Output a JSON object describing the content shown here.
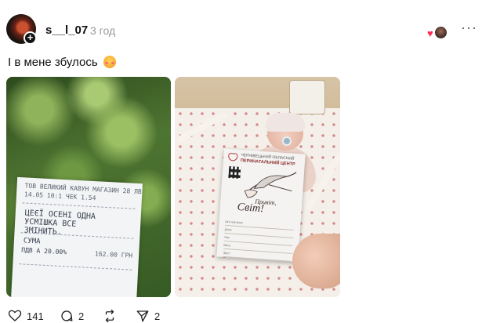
{
  "post": {
    "username": "s__l_07",
    "timestamp": "3 год",
    "caption": "І в мене збулось",
    "emoji": "flushed-face-emoji"
  },
  "icons": {
    "more": "more-options-icon",
    "plus": "follow-plus-icon",
    "heart": "heart-icon"
  },
  "images": {
    "left": {
      "kind": "photo of receipt in front of green foliage",
      "receipt_line1": "ТОВ ВЕЛИКИЙ КАВУН МАГАЗИН 28 ЛВ",
      "receipt_line2": "14.05 10:1 ЧЕК 1.54",
      "receipt_message": "ЦЕЄЇ ОСЕНІ ОДНА УСМІШКА ВСЕ ЗМІНИТЬ.",
      "receipt_sum": "СУМА",
      "receipt_sum_line": "ПДВ А 20.00%",
      "receipt_price": "162.00 ГРН"
    },
    "right": {
      "kind": "photo of newborn in crib with greeting card",
      "card_title_1": "ЧЕРНІВЕЦЬКИЙ ОБЛАСНИЙ",
      "card_title_2": "ПЕРИНАТАЛЬНИЙ ЦЕНТР",
      "card_greeting": "Привіт,",
      "card_world": "Світ!",
      "card_rows": [
        "Ім'я малюка",
        "Дата",
        "Час",
        "Вага",
        "Зріст"
      ]
    }
  },
  "actions": {
    "likes": "141",
    "comments": "2",
    "reposts": "",
    "shares": "2"
  }
}
